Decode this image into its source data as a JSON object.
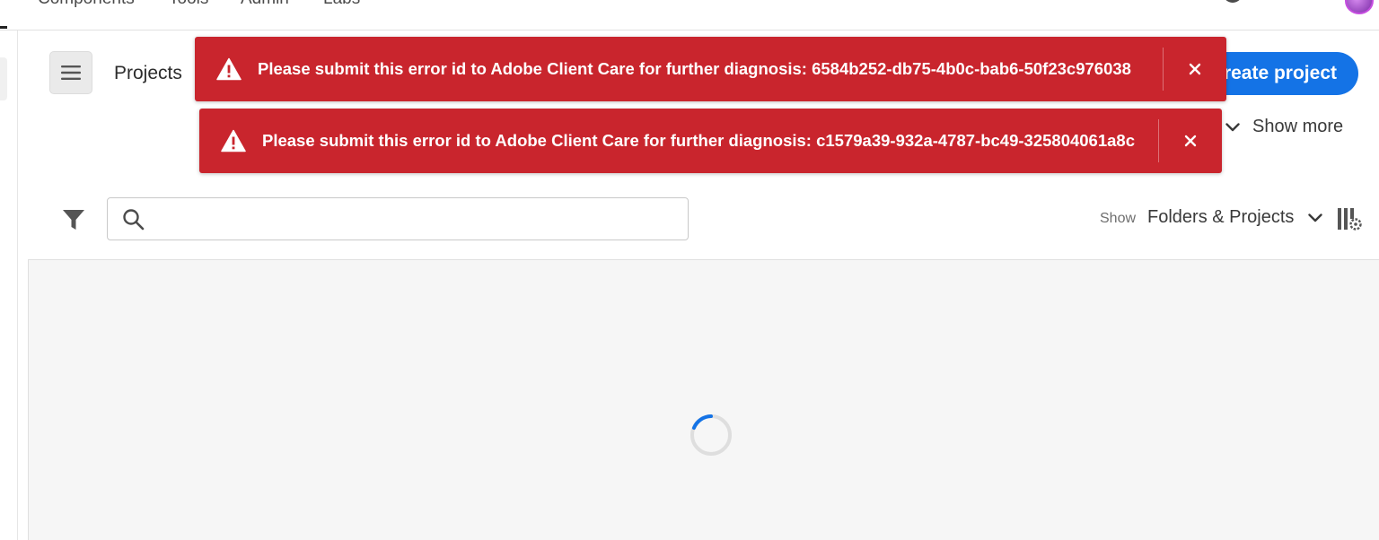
{
  "topnav": {
    "items": [
      "Components",
      "Tools",
      "Admin",
      "Labs"
    ]
  },
  "main": {
    "title": "Projects",
    "create_button": "Create project",
    "show_more": "Show more",
    "search": {
      "placeholder": "",
      "value": ""
    },
    "show_label": "Show",
    "show_select": "Folders & Projects"
  },
  "toasts": [
    {
      "message": "Please submit this error id to Adobe Client Care for further diagnosis: 6584b252-db75-4b0c-bab6-50f23c976038"
    },
    {
      "message": "Please submit this error id to Adobe Client Care for further diagnosis: c1579a39-932a-4787-bc49-325804061a8c"
    }
  ],
  "colors": {
    "toast_bg": "#c9252d",
    "accent": "#1473e6",
    "panel_bg": "#f6f6f6"
  },
  "icons": [
    "warning-icon",
    "close-icon",
    "hamburger-icon",
    "search-icon",
    "filter-icon",
    "chevron-down-icon",
    "column-settings-icon",
    "spinner-icon",
    "apps-icon",
    "help-icon",
    "bell-icon"
  ]
}
